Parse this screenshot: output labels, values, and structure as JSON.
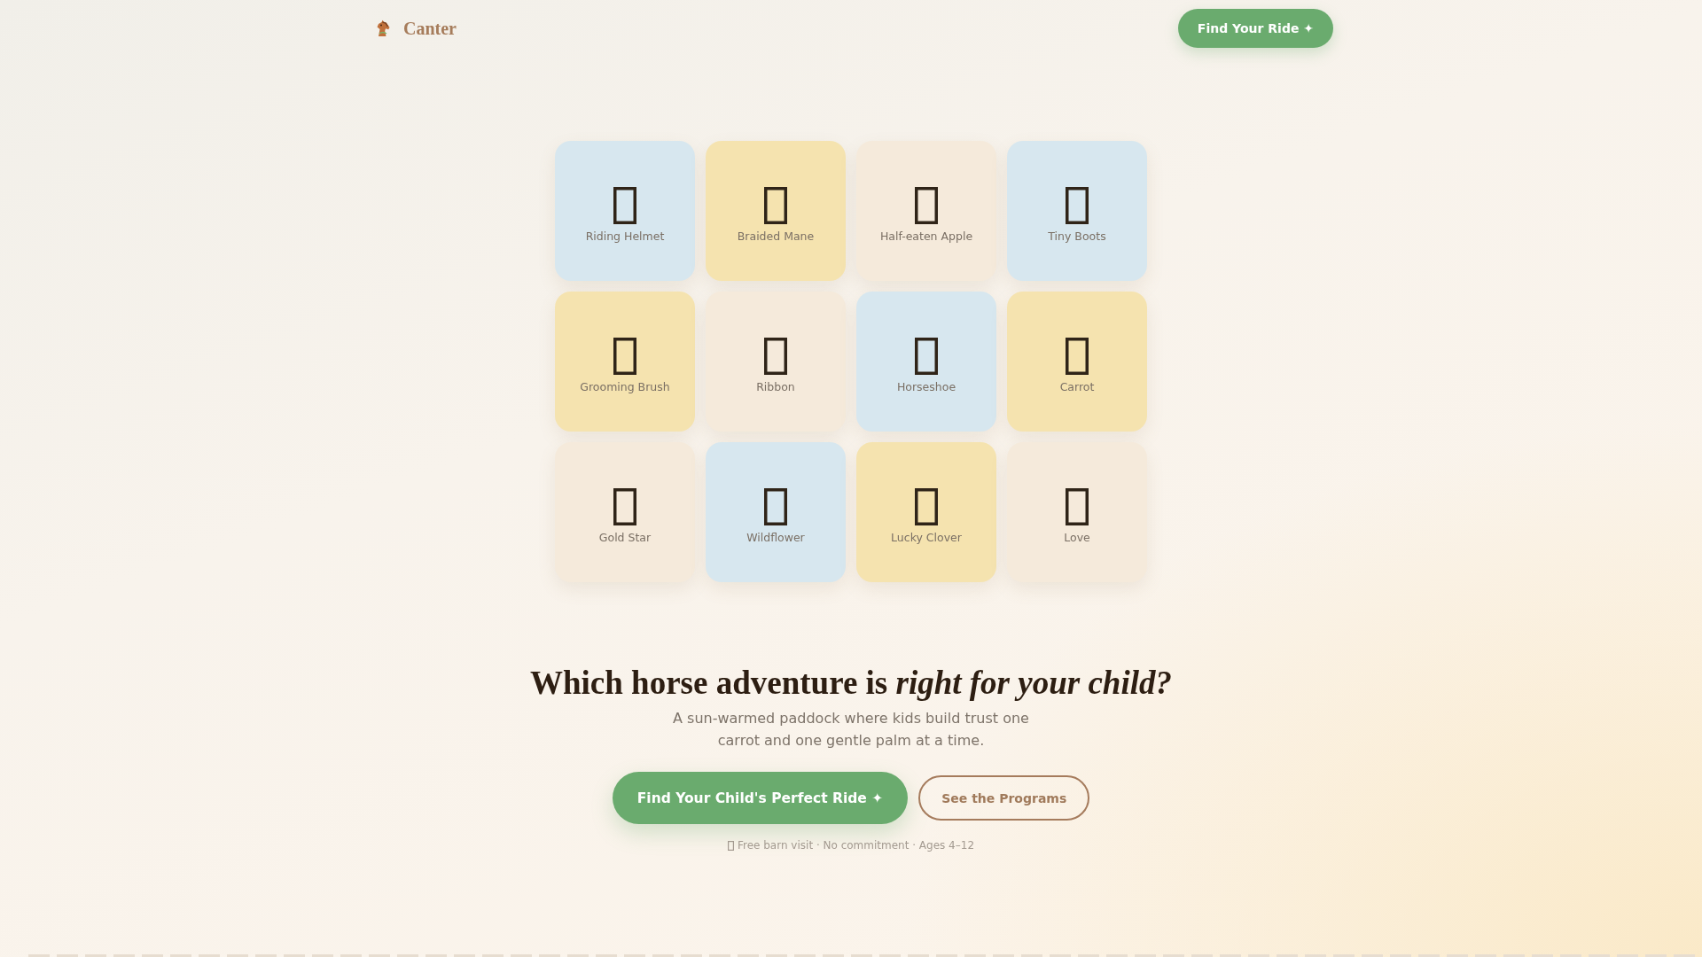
{
  "header": {
    "brand": "Canter",
    "button": "Find Your Ride ✦"
  },
  "tiles": [
    {
      "label": "Riding Helmet",
      "color": "#d7e7ef"
    },
    {
      "label": "Braided Mane",
      "color": "#f5e3af"
    },
    {
      "label": "Half-eaten Apple",
      "color": "#f5eadb"
    },
    {
      "label": "Tiny Boots",
      "color": "#d7e7ef"
    },
    {
      "label": "Grooming Brush",
      "color": "#f5e3af"
    },
    {
      "label": "Ribbon",
      "color": "#f5eadb"
    },
    {
      "label": "Horseshoe",
      "color": "#d7e7ef"
    },
    {
      "label": "Carrot",
      "color": "#f5e3af"
    },
    {
      "label": "Gold Star",
      "color": "#f5eadb"
    },
    {
      "label": "Wildflower",
      "color": "#d7e7ef"
    },
    {
      "label": "Lucky Clover",
      "color": "#f5e3af"
    },
    {
      "label": "Love",
      "color": "#f5eadb"
    }
  ],
  "hero": {
    "headline": "Which horse adventure is *right for your child?*",
    "subtitle": "A sun-warmed paddock where kids build trust one carrot and one gentle palm at a time.",
    "primary_button": "Find Your Child's Perfect Ride ✦",
    "secondary_button": "See the Programs",
    "footnote": "Free barn visit · No commitment · Ages 4–12"
  }
}
